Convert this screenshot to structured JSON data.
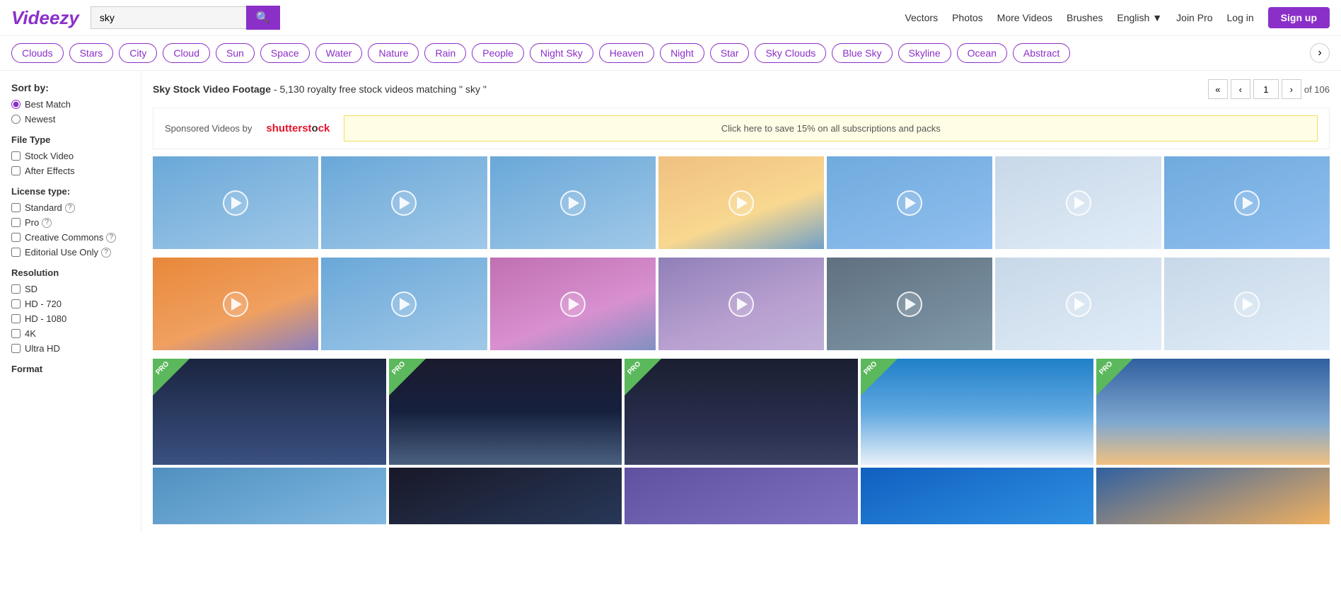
{
  "header": {
    "logo": "Videezy",
    "search_placeholder": "sky",
    "search_value": "sky",
    "nav": {
      "vectors": "Vectors",
      "photos": "Photos",
      "more_videos": "More Videos",
      "brushes": "Brushes",
      "language": "English",
      "join_pro": "Join Pro",
      "log_in": "Log in",
      "sign_up": "Sign up"
    }
  },
  "tags": [
    "Clouds",
    "Stars",
    "City",
    "Cloud",
    "Sun",
    "Space",
    "Water",
    "Nature",
    "Rain",
    "People",
    "Night Sky",
    "Heaven",
    "Night",
    "Star",
    "Sky Clouds",
    "Blue Sky",
    "Skyline",
    "Ocean",
    "Abstract"
  ],
  "sidebar": {
    "sort_by": "Sort by:",
    "sort_options": [
      {
        "label": "Best Match",
        "value": "best_match",
        "checked": true
      },
      {
        "label": "Newest",
        "value": "newest",
        "checked": false
      }
    ],
    "file_type": "File Type",
    "file_types": [
      {
        "label": "Stock Video",
        "checked": false
      },
      {
        "label": "After Effects",
        "checked": false
      }
    ],
    "license_type": "License type:",
    "licenses": [
      {
        "label": "Standard",
        "help": true,
        "checked": false
      },
      {
        "label": "Pro",
        "help": true,
        "checked": false
      },
      {
        "label": "Creative Commons",
        "help": true,
        "checked": false
      },
      {
        "label": "Editorial Use Only",
        "help": true,
        "checked": false
      }
    ],
    "resolution": "Resolution",
    "resolutions": [
      {
        "label": "SD",
        "checked": false
      },
      {
        "label": "HD - 720",
        "checked": false
      },
      {
        "label": "HD - 1080",
        "checked": false
      },
      {
        "label": "4K",
        "checked": false
      },
      {
        "label": "Ultra HD",
        "checked": false
      }
    ],
    "format": "Format"
  },
  "results": {
    "title": "Sky Stock Video Footage",
    "subtitle": "- 5,130 royalty free stock videos matching",
    "query": "\" sky \"",
    "page_current": "1",
    "page_total": "of 106"
  },
  "sponsored": {
    "text": "Sponsored Videos by",
    "brand": "shutterstock",
    "promo": "Click here to save 15% on all subscriptions and packs"
  },
  "video_rows": {
    "row1_colors": [
      "sky-blue",
      "sky-blue",
      "sky-blue",
      "sky-dusk",
      "sky-bright",
      "sky-white",
      "sky-bright"
    ],
    "row2_colors": [
      "sky-sunset",
      "sky-blue",
      "sky-pink",
      "sky-purple",
      "sky-storm",
      "sky-white",
      "sky-white"
    ]
  },
  "pro_videos": {
    "scenes": [
      "scene-city",
      "scene-bridge",
      "scene-night-city",
      "scene-sky-blue2",
      "scene-dusk2"
    ]
  },
  "bottom_row": {
    "scenes": [
      "scene-sky3",
      "scene-night2",
      "scene-purple2",
      "scene-blue2",
      "scene-dusk3"
    ]
  },
  "pro_badge_text": "PRO"
}
